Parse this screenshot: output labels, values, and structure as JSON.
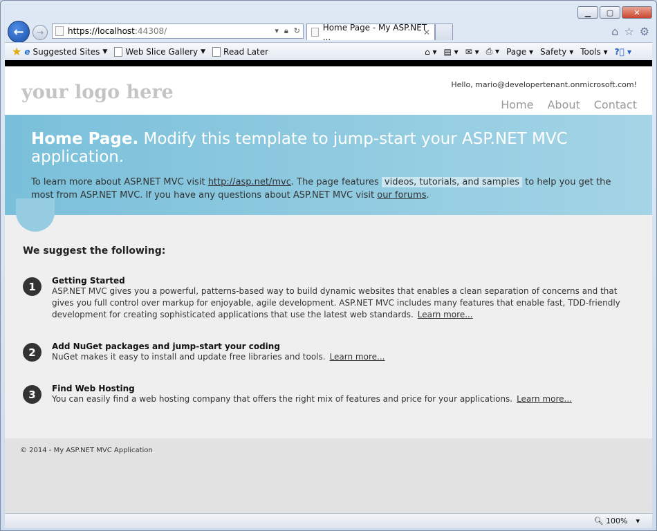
{
  "browser": {
    "address": {
      "scheme_host": "https://localhost",
      "rest": ":44308/"
    },
    "tab_title": "Home Page - My ASP.NET ...",
    "favorites": [
      {
        "label": "Suggested Sites"
      },
      {
        "label": "Web Slice Gallery"
      },
      {
        "label": "Read Later"
      }
    ],
    "commands": [
      "Page",
      "Safety",
      "Tools"
    ],
    "zoom": "100%"
  },
  "site": {
    "logo": "your logo here",
    "hello": "Hello, mario@developertenant.onmicrosoft.com!",
    "menu": [
      "Home",
      "About",
      "Contact"
    ],
    "featured": {
      "title_bold": "Home Page.",
      "title_rest": "Modify this template to jump-start your ASP.NET MVC application.",
      "p1": "To learn more about ASP.NET MVC visit",
      "link1": "http://asp.net/mvc",
      "p2": ". The page features",
      "mark": "videos, tutorials, and samples",
      "p3": "to help you get the most from ASP.NET MVC. If you have any questions about ASP.NET MVC visit",
      "link2": "our forums",
      "p4": "."
    },
    "suggest_heading": "We suggest the following:",
    "steps": [
      {
        "num": "1",
        "title": "Getting Started",
        "text": "ASP.NET MVC gives you a powerful, patterns-based way to build dynamic websites that enables a clean separation of concerns and that gives you full control over markup for enjoyable, agile development. ASP.NET MVC includes many features that enable fast, TDD-friendly development for creating sophisticated applications that use the latest web standards.",
        "link": "Learn more..."
      },
      {
        "num": "2",
        "title": "Add NuGet packages and jump-start your coding",
        "text": "NuGet makes it easy to install and update free libraries and tools.",
        "link": "Learn more..."
      },
      {
        "num": "3",
        "title": "Find Web Hosting",
        "text": "You can easily find a web hosting company that offers the right mix of features and price for your applications.",
        "link": "Learn more..."
      }
    ],
    "footer": "© 2014 - My ASP.NET MVC Application"
  }
}
